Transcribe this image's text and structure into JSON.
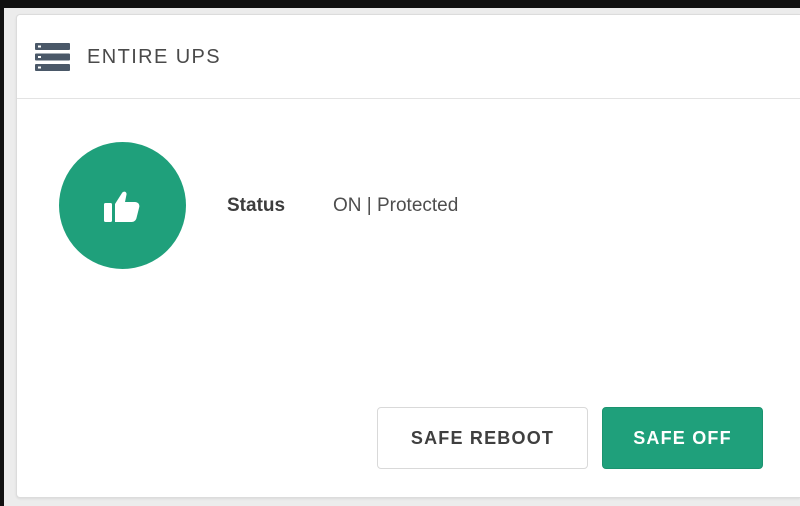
{
  "panel": {
    "title": "ENTIRE UPS",
    "header_icon": "server-stack-icon"
  },
  "status": {
    "icon": "thumbs-up-icon",
    "label": "Status",
    "value": "ON | Protected",
    "color": "#1fa07b"
  },
  "actions": {
    "safe_reboot_label": "SAFE REBOOT",
    "safe_off_label": "SAFE OFF"
  },
  "colors": {
    "accent": "#1fa07b"
  }
}
